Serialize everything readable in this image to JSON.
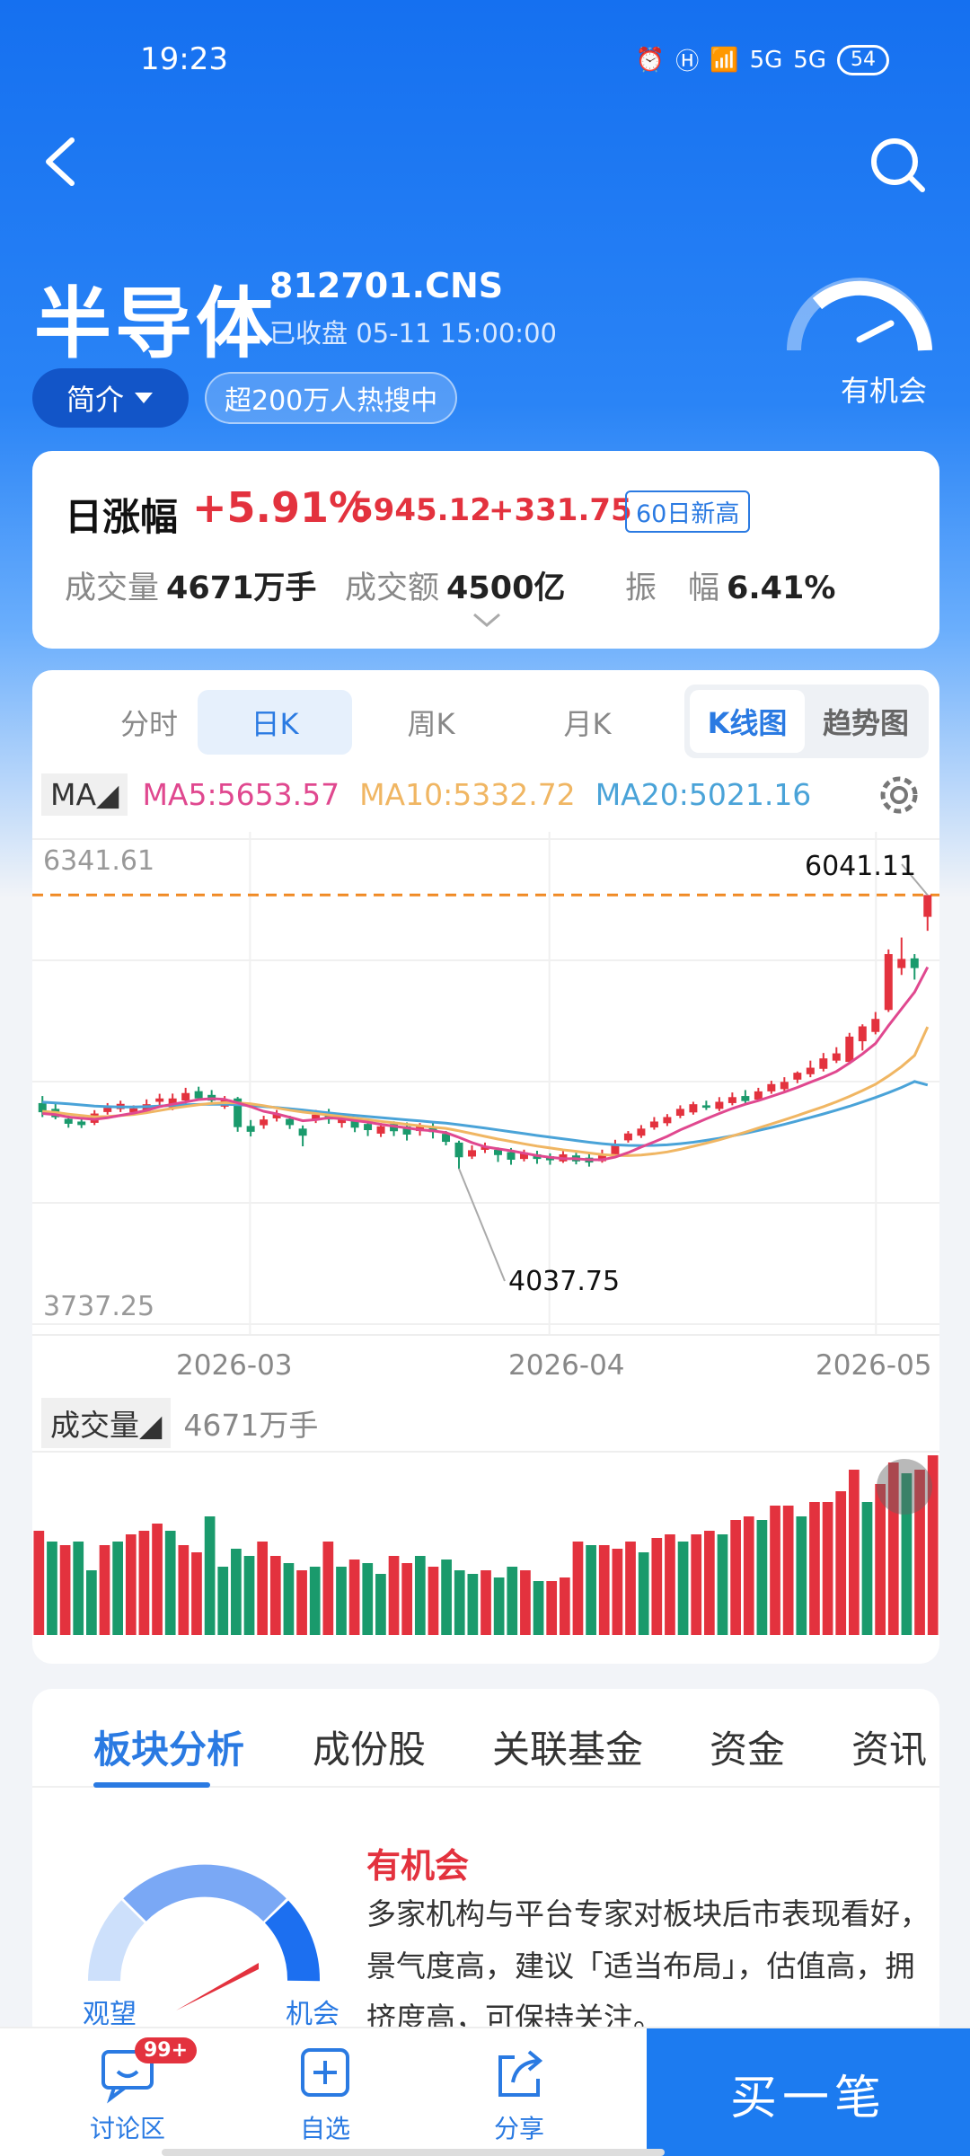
{
  "status": {
    "time": "19:23",
    "network1": "5G",
    "network2": "5G",
    "battery": "54"
  },
  "header": {
    "title": "半导体",
    "code": "812701.CNS",
    "closed_label": "已收盘",
    "closed_time": "05-11 15:00:00",
    "intro_label": "简介",
    "hot_tag": "超200万人热搜中",
    "sentiment": "有机会"
  },
  "stats": {
    "label": "日涨幅",
    "pct": "+5.91%",
    "price": "5945.12",
    "change": "+331.75",
    "badge": "60日新高",
    "volume_label": "成交量",
    "volume": "4671万手",
    "amount_label": "成交额",
    "amount": "4500亿",
    "amp_label": "振　幅",
    "amp": "6.41%"
  },
  "period_tabs": [
    "分时",
    "日K",
    "周K",
    "月K"
  ],
  "view_tabs": [
    "K线图",
    "趋势图"
  ],
  "ma": {
    "toggle": "MA",
    "ma5": "MA5:5653.57",
    "ma10": "MA10:5332.72",
    "ma20": "MA20:5021.16"
  },
  "volume_row": {
    "label": "成交量",
    "value": "4671万手"
  },
  "colors": {
    "up": "#e3323e",
    "down": "#1a9a6c",
    "ma5": "#e0488f",
    "ma10": "#f0b663",
    "ma20": "#4aa3d8",
    "accent": "#2a7ae2"
  },
  "chart_data": {
    "type": "candlestick",
    "y_axis_top": "6341.61",
    "y_axis_bottom": "3737.25",
    "ylim": [
      3737.25,
      6341.61
    ],
    "x_ticks": [
      "2026-03",
      "2026-04",
      "2026-05"
    ],
    "annotations": {
      "high": "6041.11",
      "low": "4037.75"
    },
    "reference_line": 6041.11,
    "candles": [
      [
        4924,
        4875,
        4962,
        4849
      ],
      [
        4893,
        4848,
        4924,
        4837
      ],
      [
        4839,
        4813,
        4857,
        4792
      ],
      [
        4825,
        4806,
        4848,
        4790
      ],
      [
        4818,
        4868,
        4886,
        4806
      ],
      [
        4876,
        4899,
        4924,
        4862
      ],
      [
        4892,
        4920,
        4937,
        4876
      ],
      [
        4874,
        4896,
        4912,
        4857
      ],
      [
        4881,
        4918,
        4944,
        4868
      ],
      [
        4931,
        4949,
        4974,
        4912
      ],
      [
        4901,
        4949,
        4975,
        4886
      ],
      [
        4938,
        4978,
        5006,
        4918
      ],
      [
        4988,
        4949,
        5012,
        4937
      ],
      [
        4968,
        4937,
        4994,
        4924
      ],
      [
        4905,
        4943,
        4962,
        4893
      ],
      [
        4949,
        4795,
        4957,
        4770
      ],
      [
        4801,
        4770,
        4833,
        4745
      ],
      [
        4805,
        4836,
        4856,
        4786
      ],
      [
        4842,
        4868,
        4887,
        4825
      ],
      [
        4839,
        4806,
        4856,
        4785
      ],
      [
        4787,
        4749,
        4804,
        4692
      ],
      [
        4836,
        4862,
        4887,
        4817
      ],
      [
        4868,
        4836,
        4893,
        4813
      ],
      [
        4817,
        4848,
        4868,
        4792
      ],
      [
        4836,
        4792,
        4849,
        4768
      ],
      [
        4812,
        4779,
        4832,
        4747
      ],
      [
        4760,
        4799,
        4817,
        4742
      ],
      [
        4812,
        4773,
        4826,
        4747
      ],
      [
        4799,
        4755,
        4820,
        4723
      ],
      [
        4774,
        4799,
        4817,
        4749
      ],
      [
        4793,
        4768,
        4817,
        4734
      ],
      [
        4759,
        4716,
        4774,
        4697
      ],
      [
        4712,
        4633,
        4722,
        4572
      ],
      [
        4637,
        4671,
        4697,
        4624
      ],
      [
        4673,
        4691,
        4712,
        4656
      ],
      [
        4673,
        4645,
        4686,
        4608
      ],
      [
        4661,
        4620,
        4683,
        4593
      ],
      [
        4624,
        4659,
        4674,
        4611
      ],
      [
        4649,
        4624,
        4668,
        4598
      ],
      [
        4639,
        4617,
        4654,
        4593
      ],
      [
        4611,
        4649,
        4667,
        4603
      ],
      [
        4643,
        4611,
        4657,
        4595
      ],
      [
        4631,
        4605,
        4656,
        4583
      ],
      [
        4612,
        4643,
        4674,
        4604
      ],
      [
        4649,
        4697,
        4727,
        4637
      ],
      [
        4724,
        4761,
        4774,
        4712
      ],
      [
        4749,
        4787,
        4806,
        4737
      ],
      [
        4793,
        4825,
        4849,
        4781
      ],
      [
        4816,
        4849,
        4865,
        4801
      ],
      [
        4856,
        4893,
        4912,
        4843
      ],
      [
        4874,
        4918,
        4931,
        4862
      ],
      [
        4912,
        4899,
        4937,
        4887
      ],
      [
        4893,
        4931,
        4956,
        4881
      ],
      [
        4924,
        4956,
        4981,
        4912
      ],
      [
        4962,
        4935,
        4994,
        4924
      ],
      [
        4943,
        4987,
        5006,
        4931
      ],
      [
        4987,
        5026,
        5044,
        4974
      ],
      [
        4999,
        5038,
        5063,
        4987
      ],
      [
        5050,
        5087,
        5094,
        5031
      ],
      [
        5079,
        5114,
        5152,
        5063
      ],
      [
        5108,
        5164,
        5193,
        5094
      ],
      [
        5152,
        5191,
        5224,
        5139
      ],
      [
        5145,
        5281,
        5301,
        5139
      ],
      [
        5256,
        5336,
        5347,
        5206
      ],
      [
        5306,
        5376,
        5413,
        5293
      ],
      [
        5424,
        5724,
        5749,
        5413
      ],
      [
        5649,
        5698,
        5813,
        5612
      ],
      [
        5701,
        5649,
        5724,
        5587
      ],
      [
        5924,
        6041,
        6041,
        5849
      ]
    ],
    "ma5": [
      4868,
      4862,
      4849,
      4842,
      4837,
      4845,
      4858,
      4870,
      4885,
      4905,
      4918,
      4930,
      4943,
      4948,
      4944,
      4925,
      4905,
      4880,
      4866,
      4848,
      4829,
      4835,
      4845,
      4840,
      4830,
      4822,
      4810,
      4800,
      4791,
      4781,
      4775,
      4765,
      4740,
      4712,
      4690,
      4678,
      4668,
      4655,
      4642,
      4633,
      4626,
      4625,
      4620,
      4620,
      4634,
      4658,
      4688,
      4716,
      4745,
      4780,
      4810,
      4840,
      4868,
      4895,
      4918,
      4937,
      4960,
      4983,
      5008,
      5036,
      5063,
      5094,
      5139,
      5188,
      5244,
      5340,
      5430,
      5520,
      5654
    ],
    "ma10": [
      4880,
      4874,
      4865,
      4857,
      4850,
      4852,
      4857,
      4863,
      4872,
      4884,
      4896,
      4906,
      4915,
      4922,
      4926,
      4925,
      4920,
      4910,
      4898,
      4886,
      4876,
      4868,
      4860,
      4852,
      4843,
      4835,
      4826,
      4818,
      4810,
      4802,
      4795,
      4788,
      4775,
      4760,
      4745,
      4731,
      4718,
      4705,
      4693,
      4683,
      4673,
      4665,
      4656,
      4648,
      4643,
      4642,
      4645,
      4652,
      4662,
      4676,
      4692,
      4709,
      4727,
      4747,
      4768,
      4790,
      4812,
      4834,
      4857,
      4881,
      4905,
      4931,
      4960,
      4991,
      5025,
      5070,
      5120,
      5180,
      5333
    ],
    "ma20": [
      4929,
      4925,
      4920,
      4914,
      4908,
      4905,
      4903,
      4903,
      4905,
      4908,
      4912,
      4915,
      4917,
      4918,
      4918,
      4915,
      4911,
      4906,
      4900,
      4894,
      4887,
      4879,
      4871,
      4864,
      4858,
      4852,
      4846,
      4840,
      4834,
      4828,
      4822,
      4816,
      4808,
      4799,
      4790,
      4780,
      4770,
      4760,
      4750,
      4741,
      4732,
      4723,
      4714,
      4706,
      4700,
      4697,
      4696,
      4697,
      4700,
      4706,
      4714,
      4724,
      4735,
      4748,
      4762,
      4777,
      4793,
      4810,
      4828,
      4847,
      4866,
      4886,
      4907,
      4930,
      4954,
      4980,
      5008,
      5040,
      5021
    ],
    "volumes": [
      [
        0.58,
        "up"
      ],
      [
        0.52,
        "down"
      ],
      [
        0.5,
        "up"
      ],
      [
        0.52,
        "down"
      ],
      [
        0.36,
        "down"
      ],
      [
        0.5,
        "up"
      ],
      [
        0.52,
        "down"
      ],
      [
        0.56,
        "up"
      ],
      [
        0.58,
        "up"
      ],
      [
        0.62,
        "up"
      ],
      [
        0.58,
        "down"
      ],
      [
        0.5,
        "up"
      ],
      [
        0.46,
        "up"
      ],
      [
        0.66,
        "down"
      ],
      [
        0.38,
        "down"
      ],
      [
        0.48,
        "down"
      ],
      [
        0.44,
        "down"
      ],
      [
        0.52,
        "up"
      ],
      [
        0.44,
        "up"
      ],
      [
        0.4,
        "down"
      ],
      [
        0.36,
        "up"
      ],
      [
        0.38,
        "down"
      ],
      [
        0.52,
        "up"
      ],
      [
        0.38,
        "down"
      ],
      [
        0.42,
        "up"
      ],
      [
        0.4,
        "down"
      ],
      [
        0.34,
        "down"
      ],
      [
        0.44,
        "up"
      ],
      [
        0.4,
        "up"
      ],
      [
        0.44,
        "down"
      ],
      [
        0.38,
        "up"
      ],
      [
        0.42,
        "down"
      ],
      [
        0.36,
        "down"
      ],
      [
        0.34,
        "down"
      ],
      [
        0.36,
        "up"
      ],
      [
        0.32,
        "down"
      ],
      [
        0.38,
        "down"
      ],
      [
        0.36,
        "up"
      ],
      [
        0.3,
        "down"
      ],
      [
        0.3,
        "up"
      ],
      [
        0.32,
        "up"
      ],
      [
        0.52,
        "up"
      ],
      [
        0.5,
        "down"
      ],
      [
        0.5,
        "up"
      ],
      [
        0.48,
        "up"
      ],
      [
        0.52,
        "up"
      ],
      [
        0.46,
        "down"
      ],
      [
        0.54,
        "up"
      ],
      [
        0.56,
        "up"
      ],
      [
        0.52,
        "down"
      ],
      [
        0.56,
        "up"
      ],
      [
        0.58,
        "up"
      ],
      [
        0.56,
        "down"
      ],
      [
        0.64,
        "up"
      ],
      [
        0.66,
        "up"
      ],
      [
        0.64,
        "down"
      ],
      [
        0.72,
        "up"
      ],
      [
        0.72,
        "up"
      ],
      [
        0.66,
        "down"
      ],
      [
        0.74,
        "up"
      ],
      [
        0.74,
        "up"
      ],
      [
        0.8,
        "up"
      ],
      [
        0.92,
        "up"
      ],
      [
        0.74,
        "down"
      ],
      [
        0.84,
        "up"
      ],
      [
        0.96,
        "up"
      ],
      [
        0.9,
        "down"
      ],
      [
        0.92,
        "up"
      ],
      [
        1.0,
        "up"
      ]
    ]
  },
  "analysis": {
    "tabs": [
      "板块分析",
      "成份股",
      "关联基金",
      "资金",
      "资讯"
    ],
    "title": "有机会",
    "text": "多家机构与平台专家对板块后市表现看好，景气度高，建议「适当布局」，估值高，拥挤度高，可保持关注。",
    "gauge_left": "观望",
    "gauge_right": "机会"
  },
  "bottom_nav": {
    "discuss": "讨论区",
    "discuss_badge": "99+",
    "watch": "自选",
    "share": "分享",
    "buy": "买一笔"
  }
}
